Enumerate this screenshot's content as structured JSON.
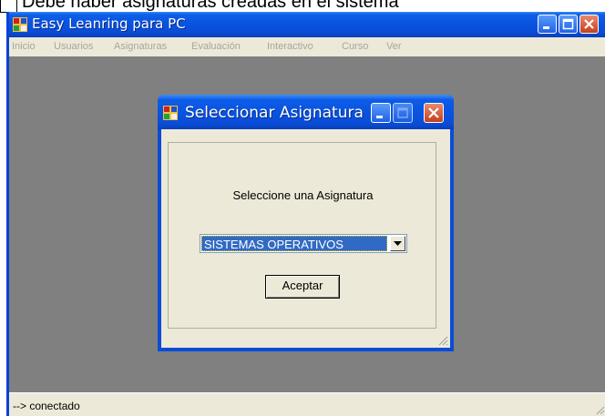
{
  "document": {
    "cut_text": "Debe haber asignaturas creadas en el sistema"
  },
  "main_window": {
    "title": "Easy Leanring para PC",
    "menu": [
      "Inicio",
      "Usuarios",
      "Asignaturas",
      "Evaluación",
      "Interactivo",
      "Curso",
      "Ver"
    ],
    "status": "--> conectado"
  },
  "dialog": {
    "title": "Seleccionar Asignatura",
    "prompt": "Seleccione una Asignatura",
    "selected_subject": "SISTEMAS OPERATIVOS",
    "accept_label": "Aceptar"
  },
  "colors": {
    "titlebar_blue": "#0a4cd6",
    "client_gray": "#808080",
    "selection_blue": "#316ac5",
    "window_face": "#ece9d8"
  },
  "icons": [
    "app-icon",
    "minimize-icon",
    "maximize-icon",
    "close-icon",
    "dropdown-arrow-icon",
    "resize-grip-icon"
  ]
}
